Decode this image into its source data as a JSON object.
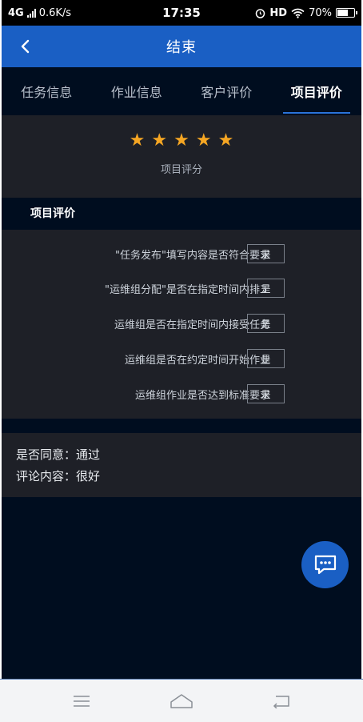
{
  "status_bar": {
    "network": "4G",
    "speed": "0.6K/s",
    "time": "17:35",
    "hd": "HD",
    "battery_text": "70%",
    "battery_level": 0.7
  },
  "header": {
    "title": "结束",
    "back_icon": "chevron-left-icon"
  },
  "tabs": [
    {
      "label": "任务信息",
      "active": false
    },
    {
      "label": "作业信息",
      "active": false
    },
    {
      "label": "客户评价",
      "active": false
    },
    {
      "label": "项目评价",
      "active": true
    }
  ],
  "rating": {
    "stars": 5,
    "max_stars": 5,
    "label": "项目评分",
    "star_color": "#f5a623"
  },
  "section_title": "项目评价",
  "evaluations": [
    {
      "question": "\"任务发布\"填写内容是否符合要求",
      "answer": "是"
    },
    {
      "question": "\"运维组分配\"是否在指定时间内排工",
      "answer": "是"
    },
    {
      "question": "运维组是否在指定时间内接受任务",
      "answer": "是"
    },
    {
      "question": "运维组是否在约定时间开始作业",
      "answer": "是"
    },
    {
      "question": "运维组作业是否达到标准要求",
      "answer": "是"
    }
  ],
  "summary": {
    "agree": "是否同意：通过",
    "comment": "评论内容：很好"
  },
  "fab": {
    "icon": "chat-icon"
  },
  "nav_bar": {
    "menu_icon": "menu-icon",
    "home_icon": "home-icon",
    "back_icon": "back-arrow-icon"
  },
  "colors": {
    "accent": "#1a5fc4",
    "background": "#000d1f",
    "panel": "#1e2027"
  }
}
